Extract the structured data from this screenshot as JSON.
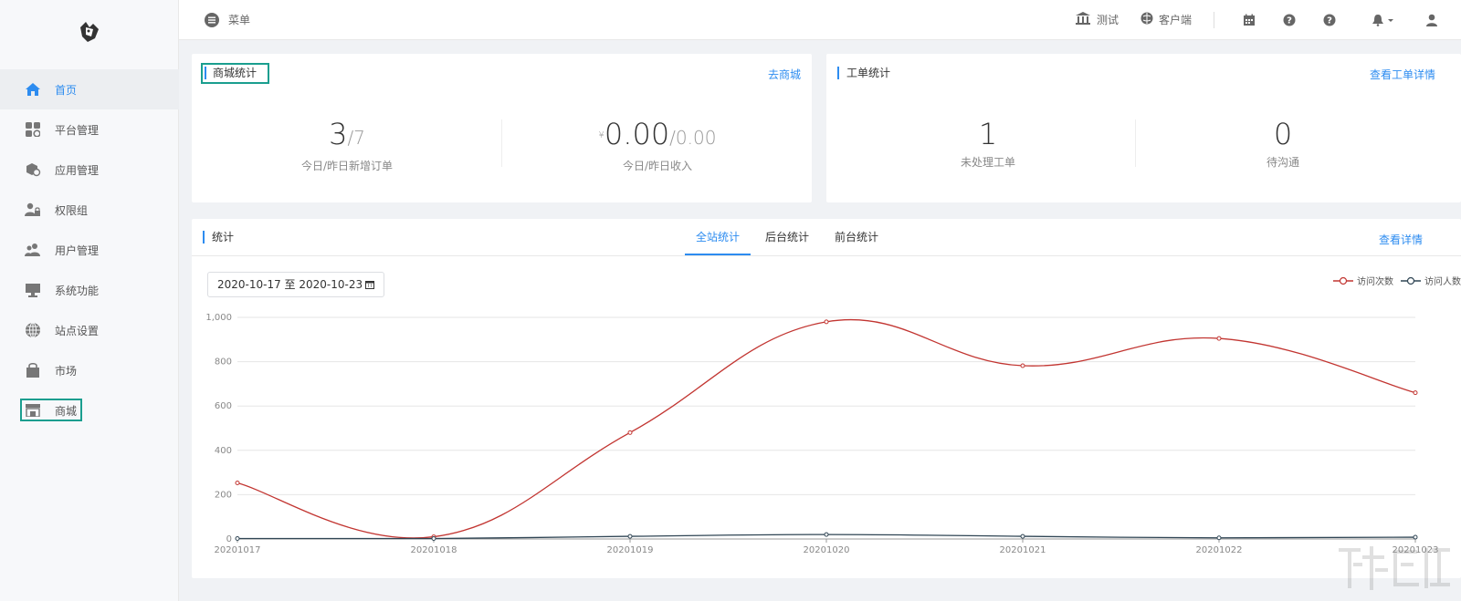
{
  "sidebar": {
    "items": [
      {
        "label": "首页",
        "icon": "home-icon",
        "active": true
      },
      {
        "label": "平台管理",
        "icon": "grid-icon"
      },
      {
        "label": "应用管理",
        "icon": "package-icon"
      },
      {
        "label": "权限组",
        "icon": "user-lock-icon"
      },
      {
        "label": "用户管理",
        "icon": "users-icon"
      },
      {
        "label": "系统功能",
        "icon": "monitor-icon"
      },
      {
        "label": "站点设置",
        "icon": "globe-icon"
      },
      {
        "label": "市场",
        "icon": "bag-icon"
      },
      {
        "label": "商城",
        "icon": "store-icon",
        "highlighted": true
      }
    ]
  },
  "header": {
    "menu_label": "菜单",
    "test_label": "测试",
    "client_label": "客户端"
  },
  "shop_stats": {
    "title": "商城统计",
    "link": "去商城",
    "orders_today": "3",
    "orders_yesterday": "/7",
    "orders_label": "今日/昨日新增订单",
    "currency": "¥",
    "income_today": "0.00",
    "income_yesterday": "/0.00",
    "income_label": "今日/昨日收入"
  },
  "ticket_stats": {
    "title": "工单统计",
    "link": "查看工单详情",
    "pending": "1",
    "pending_label": "未处理工单",
    "to_communicate": "0",
    "to_communicate_label": "待沟通"
  },
  "stats": {
    "title": "统计",
    "tabs": [
      "全站统计",
      "后台统计",
      "前台统计"
    ],
    "active_tab": 0,
    "link": "查看详情",
    "date_range": "2020-10-17 至 2020-10-23"
  },
  "colors": {
    "accent": "#2d8cf0",
    "series_visits": "#c23531",
    "series_visitors": "#2f4554",
    "highlight_box": "#1a9e8f"
  },
  "chart_data": {
    "type": "line",
    "x": [
      "20201017",
      "20201018",
      "20201019",
      "20201020",
      "20201021",
      "20201022",
      "20201023"
    ],
    "series": [
      {
        "name": "访问次数",
        "values": [
          253,
          10,
          480,
          980,
          782,
          905,
          660
        ]
      },
      {
        "name": "访问人数",
        "values": [
          2,
          2,
          12,
          20,
          12,
          5,
          8
        ]
      }
    ],
    "ylim": [
      0,
      1000
    ],
    "yticks": [
      0,
      200,
      400,
      600,
      800,
      1000
    ],
    "ytick_labels": [
      "0",
      "200",
      "400",
      "600",
      "800",
      "1,000"
    ],
    "smooth": true,
    "grid": true,
    "legend": "top-right"
  }
}
